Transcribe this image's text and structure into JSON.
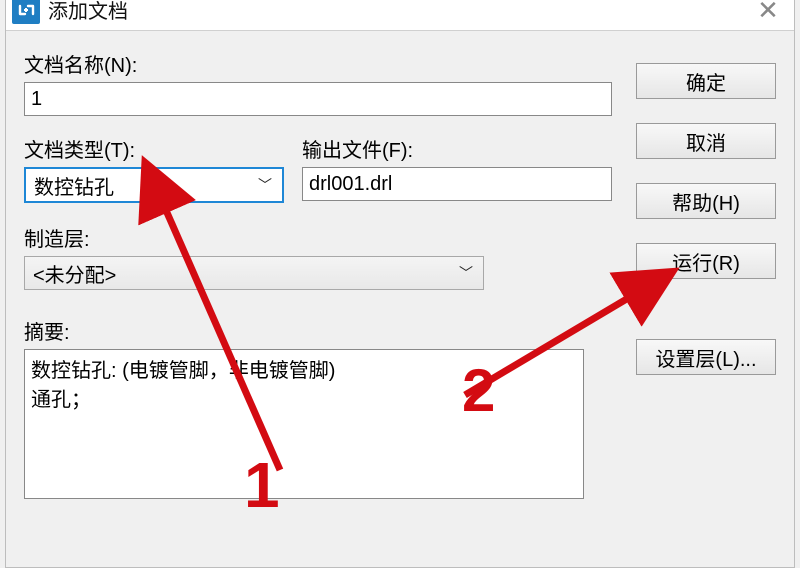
{
  "window": {
    "title": "添加文档"
  },
  "labels": {
    "doc_name": "文档名称(N):",
    "doc_type": "文档类型(T):",
    "output_file": "输出文件(F):",
    "mfg_layer": "制造层:",
    "summary": "摘要:"
  },
  "fields": {
    "doc_name_value": "1",
    "doc_type_value": "数控钻孔",
    "output_file_value": "drl001.drl",
    "mfg_layer_value": "<未分配>",
    "summary_value": "数控钻孔: (电镀管脚，非电镀管脚)\n通孔；"
  },
  "buttons": {
    "ok": "确定",
    "cancel": "取消",
    "help": "帮助(H)",
    "run": "运行(R)",
    "set_layer": "设置层(L)..."
  },
  "annotations": {
    "num1": "1",
    "num2": "2"
  }
}
